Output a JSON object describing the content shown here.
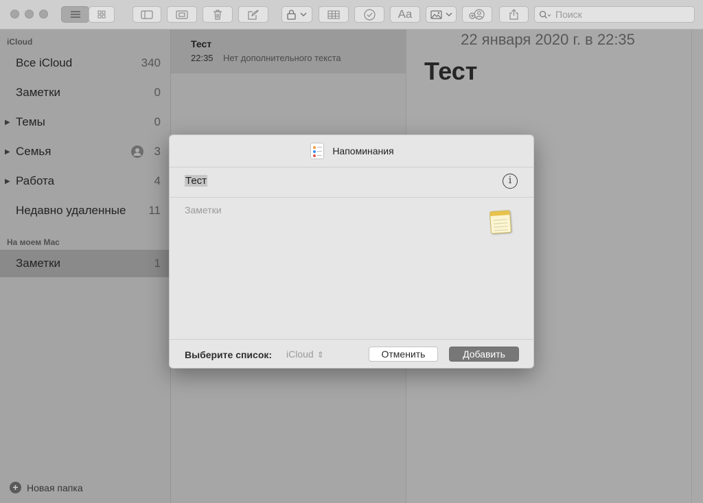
{
  "toolbar": {
    "search_placeholder": "Поиск",
    "font_button_label": "Aa"
  },
  "sidebar": {
    "sections": [
      {
        "header": "iCloud",
        "items": [
          {
            "label": "Все iCloud",
            "count": "340"
          },
          {
            "label": "Заметки",
            "count": "0"
          },
          {
            "label": "Темы",
            "count": "0"
          },
          {
            "label": "Семья",
            "count": "3"
          },
          {
            "label": "Работа",
            "count": "4"
          },
          {
            "label": "Недавно удаленные",
            "count": "11"
          }
        ]
      },
      {
        "header": "На моем Mac",
        "items": [
          {
            "label": "Заметки",
            "count": "1"
          }
        ]
      }
    ],
    "new_folder_label": "Новая папка"
  },
  "note_list": {
    "items": [
      {
        "title": "Тест",
        "time": "22:35",
        "preview": "Нет дополнительного текста"
      }
    ]
  },
  "editor": {
    "date": "22 января 2020 г. в 22:35",
    "title": "Тест"
  },
  "dialog": {
    "title": "Напоминания",
    "reminder_title": "Тест",
    "notes_placeholder": "Заметки",
    "list_label": "Выберите список:",
    "list_value": "iCloud",
    "cancel_label": "Отменить",
    "add_label": "Добавить"
  },
  "colors": {
    "sidebar_bg": "#a4a4a4",
    "selected_row": "#8a8a8a",
    "dialog_bg": "#e6e6e6",
    "primary_button": "#777777"
  }
}
